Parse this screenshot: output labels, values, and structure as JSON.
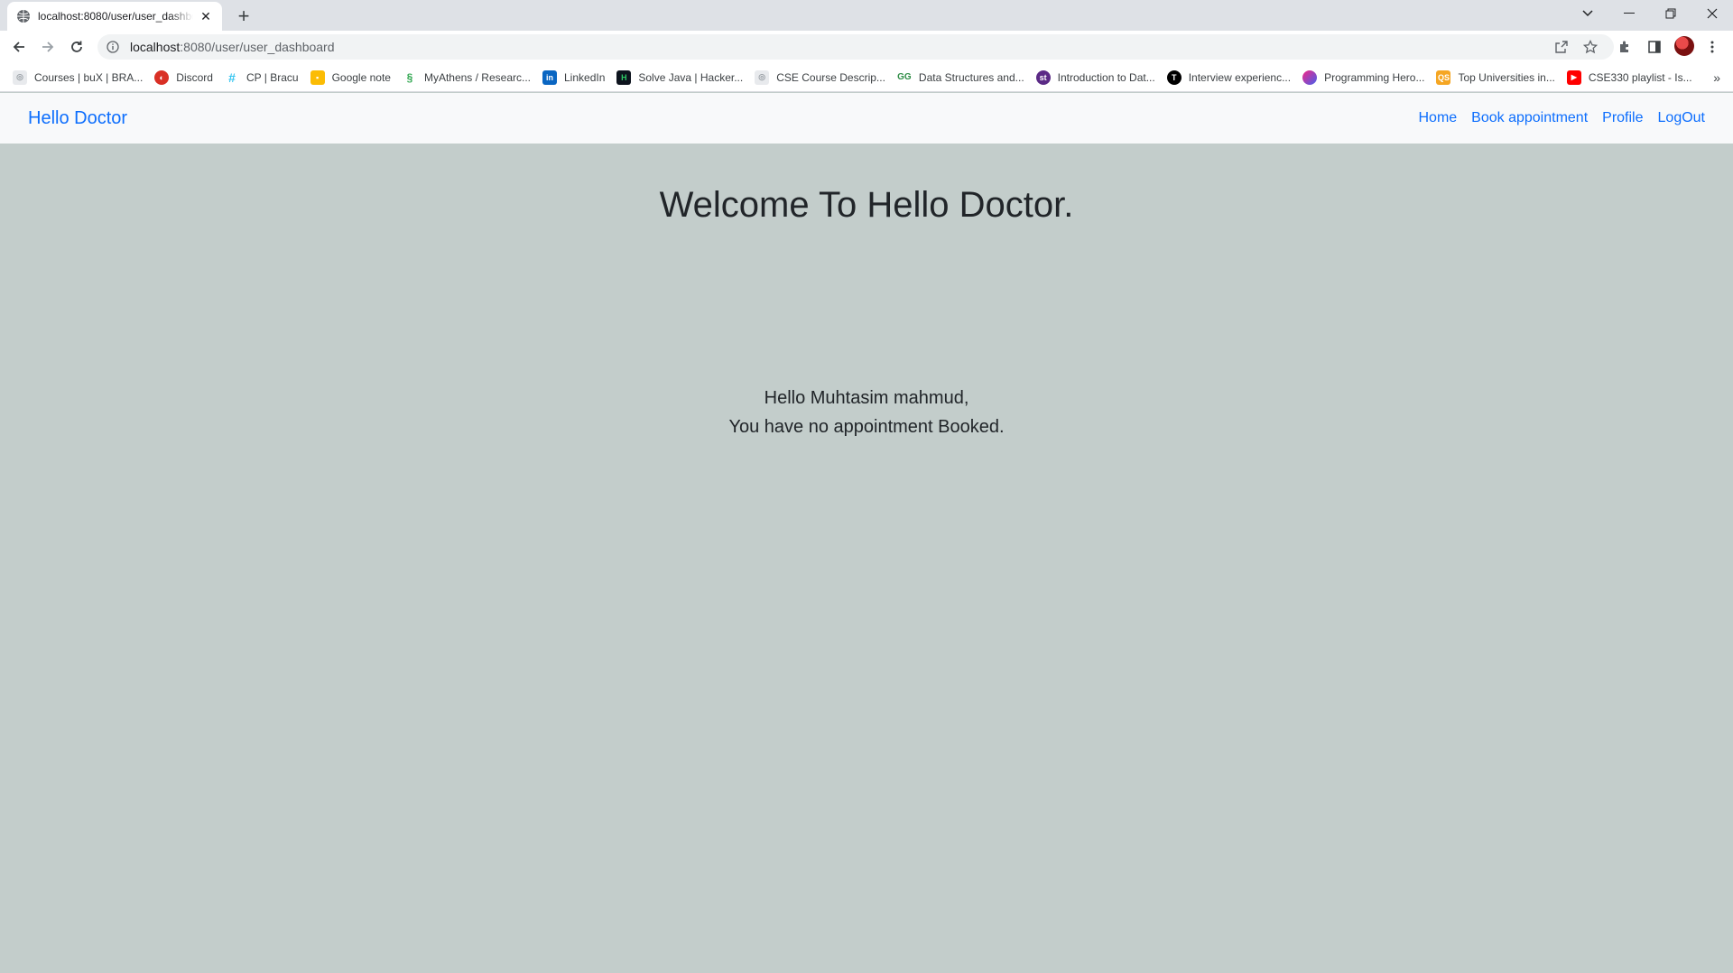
{
  "browser": {
    "tab_title": "localhost:8080/user/user_dashboard",
    "url_host": "localhost",
    "url_rest": ":8080/user/user_dashboard",
    "bookmarks": [
      {
        "label": "Courses | buX | BRA...",
        "icon": "bux-icon",
        "color": "#9aa0a6"
      },
      {
        "label": "Discord",
        "icon": "discord-icon",
        "color": "#d93025"
      },
      {
        "label": "CP | Bracu",
        "icon": "slack-icon",
        "color": "#611f69"
      },
      {
        "label": "Google note",
        "icon": "keep-icon",
        "color": "#fbbc04"
      },
      {
        "label": "MyAthens / Researc...",
        "icon": "myathens-icon",
        "color": "#34a853"
      },
      {
        "label": "LinkedIn",
        "icon": "linkedin-icon",
        "color": "#0a66c2"
      },
      {
        "label": "Solve Java | Hacker...",
        "icon": "hackerrank-icon",
        "color": "#0e141e"
      },
      {
        "label": "CSE Course Descrip...",
        "icon": "bracu-icon",
        "color": "#9aa0a6"
      },
      {
        "label": "Data Structures and...",
        "icon": "gfg-icon",
        "color": "#2f8d46"
      },
      {
        "label": "Introduction to Dat...",
        "icon": "si-icon",
        "color": "#5b2a86"
      },
      {
        "label": "Interview experienc...",
        "icon": "t-icon",
        "color": "#000000"
      },
      {
        "label": "Programming Hero...",
        "icon": "programming-hero-icon",
        "color": "#c724b1"
      },
      {
        "label": "Top Universities in...",
        "icon": "qs-icon",
        "color": "#f5a623"
      },
      {
        "label": "CSE330 playlist - Is...",
        "icon": "youtube-icon",
        "color": "#ff0000"
      }
    ]
  },
  "navbar": {
    "brand": "Hello Doctor",
    "links": [
      "Home",
      "Book appointment",
      "Profile",
      "LogOut"
    ]
  },
  "main": {
    "heading": "Welcome To Hello Doctor.",
    "greeting_line1": "Hello Muhtasim mahmud,",
    "greeting_line2": "You have no appointment Booked."
  },
  "colors": {
    "accent": "#0d6efd",
    "page_bg": "#c3cdcb",
    "navbar_bg": "#f8f9fa",
    "text": "#212529"
  }
}
